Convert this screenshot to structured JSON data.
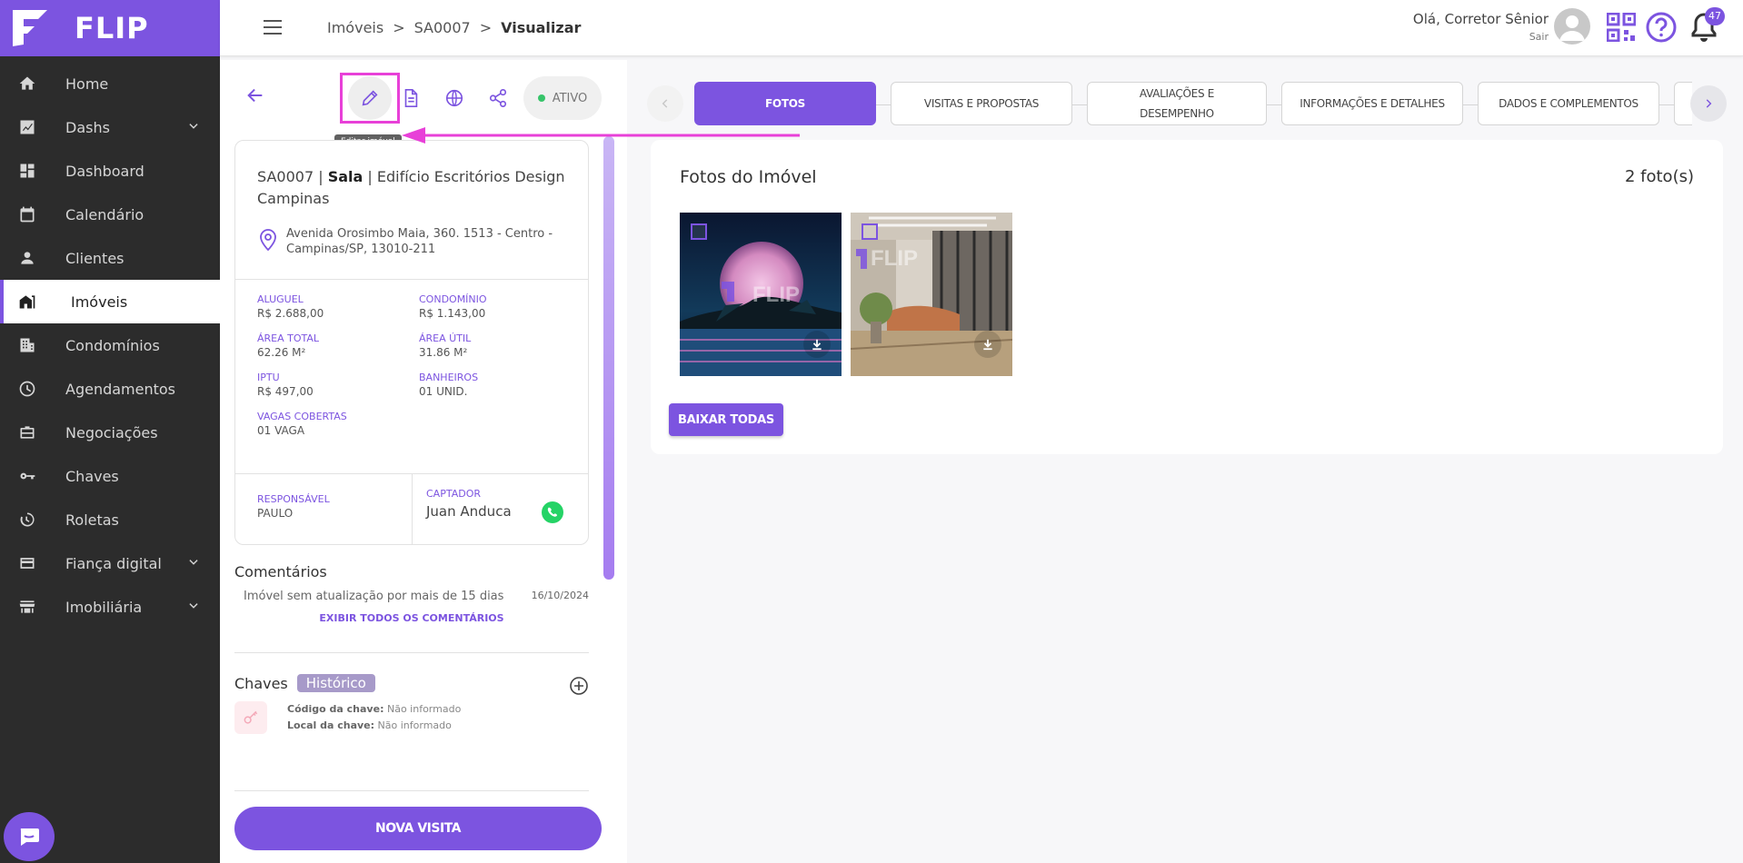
{
  "brand": {
    "name": "FLIP",
    "accent": "#7c54e0",
    "highlight": "#e840d8"
  },
  "sidebar": {
    "items": [
      {
        "label": "Home",
        "icon": "home-icon"
      },
      {
        "label": "Dashs",
        "icon": "chart-icon",
        "expandable": true
      },
      {
        "label": "Dashboard",
        "icon": "dashboard-icon"
      },
      {
        "label": "Calendário",
        "icon": "calendar-icon"
      },
      {
        "label": "Clientes",
        "icon": "person-icon"
      },
      {
        "label": "Imóveis",
        "icon": "house-icon",
        "active": true
      },
      {
        "label": "Condomínios",
        "icon": "building-icon"
      },
      {
        "label": "Agendamentos",
        "icon": "clock-icon"
      },
      {
        "label": "Negociações",
        "icon": "briefcase-icon"
      },
      {
        "label": "Chaves",
        "icon": "key-icon"
      },
      {
        "label": "Roletas",
        "icon": "roulette-icon"
      },
      {
        "label": "Fiança digital",
        "icon": "card-icon",
        "expandable": true
      },
      {
        "label": "Imobiliária",
        "icon": "store-icon",
        "expandable": true
      }
    ]
  },
  "header": {
    "breadcrumb": [
      "Imóveis",
      ">",
      "SA0007",
      ">",
      "Visualizar"
    ],
    "greeting": "Olá, Corretor Sênior",
    "logout": "Sair",
    "notifications": "47"
  },
  "toolbar": {
    "edit_tooltip": "Editar imóvel",
    "status": "ATIVO"
  },
  "property": {
    "code": "SA0007",
    "type": "Sala",
    "name": "Edifício Escritórios Design Campinas",
    "address": "Avenida Orosimbo Maia, 360. 1513 - Centro - Campinas/SP, 13010-211",
    "specs": [
      {
        "label": "ALUGUEL",
        "value": "R$ 2.688,00"
      },
      {
        "label": "CONDOMÍNIO",
        "value": "R$ 1.143,00"
      },
      {
        "label": "ÁREA TOTAL",
        "value": "62.26 M²"
      },
      {
        "label": "ÁREA ÚTIL",
        "value": "31.86 M²"
      },
      {
        "label": "IPTU",
        "value": "R$ 497,00"
      },
      {
        "label": "BANHEIROS",
        "value": "01 UNID."
      },
      {
        "label": "VAGAS COBERTAS",
        "value": "01 VAGA"
      }
    ],
    "responsible_label": "RESPONSÁVEL",
    "responsible": "PAULO",
    "captador_label": "CAPTADOR",
    "captador": "Juan Anduca"
  },
  "comments": {
    "title": "Comentários",
    "items": [
      {
        "text": "Imóvel sem atualização por mais de 15 dias",
        "date": "16/10/2024"
      }
    ],
    "show_all": "EXIBIR TODOS OS COMENTÁRIOS"
  },
  "keys": {
    "title": "Chaves",
    "history": "Histórico",
    "code_label": "Código da chave:",
    "code_value": "Não informado",
    "place_label": "Local da chave:",
    "place_value": "Não informado"
  },
  "new_visit": "NOVA VISITA",
  "tabs": [
    {
      "label": "FOTOS",
      "active": true
    },
    {
      "label": "VISITAS E PROPOSTAS"
    },
    {
      "label": "AVALIAÇÕES E DESEMPENHO"
    },
    {
      "label": "INFORMAÇÕES E DETALHES"
    },
    {
      "label": "DADOS E COMPLEMENTOS"
    }
  ],
  "photos": {
    "title": "Fotos do Imóvel",
    "count": "2 foto(s)",
    "watermark": "FLIP",
    "download_all": "BAIXAR TODAS"
  }
}
